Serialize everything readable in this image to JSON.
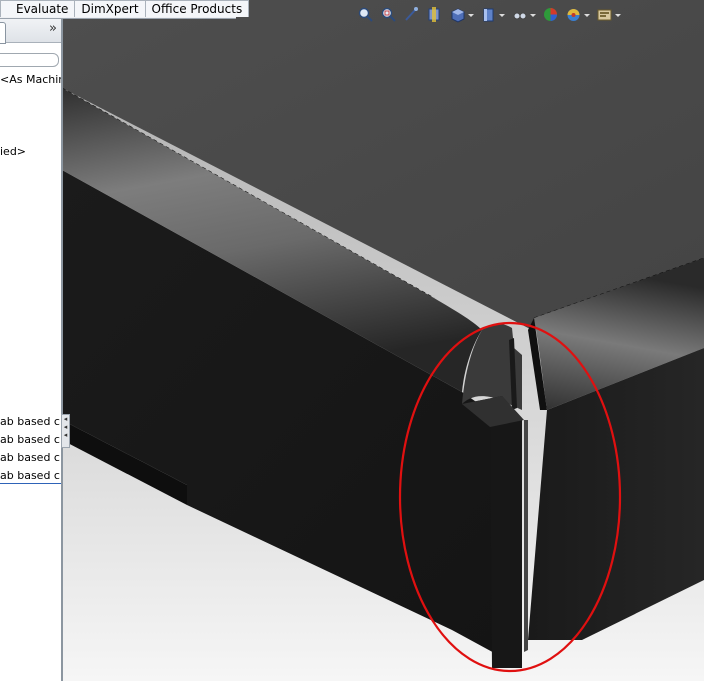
{
  "tabs": [
    {
      "label": "Evaluate"
    },
    {
      "label": "DimXpert"
    },
    {
      "label": "Office Products"
    }
  ],
  "panel": {
    "expand_glyph": "»",
    "tree": [
      {
        "text": "<As Machined"
      },
      {
        "text": "ied>"
      }
    ],
    "configurations": [
      {
        "text": "ab based cntr"
      },
      {
        "text": "ab based cntr"
      },
      {
        "text": "ab based cntr"
      },
      {
        "text": "ab based cntr"
      }
    ],
    "splitter_glyph": "◂ ◂ ◂"
  },
  "view_toolbar": [
    {
      "icon": "zoom-to-fit-icon"
    },
    {
      "icon": "zoom-to-area-icon"
    },
    {
      "icon": "previous-view-icon"
    },
    {
      "icon": "section-view-icon"
    },
    {
      "icon": "view-orientation-icon",
      "dropdown": true
    },
    {
      "icon": "display-style-icon",
      "dropdown": true
    },
    {
      "icon": "hide-show-items-icon",
      "dropdown": true
    },
    {
      "icon": "edit-appearance-icon"
    },
    {
      "icon": "apply-scene-icon",
      "dropdown": true
    },
    {
      "icon": "view-settings-icon",
      "dropdown": true
    }
  ],
  "colors": {
    "highlight_ellipse": "#e01010",
    "model": "#1e1e1e",
    "top_face": "#4a4a4a"
  }
}
